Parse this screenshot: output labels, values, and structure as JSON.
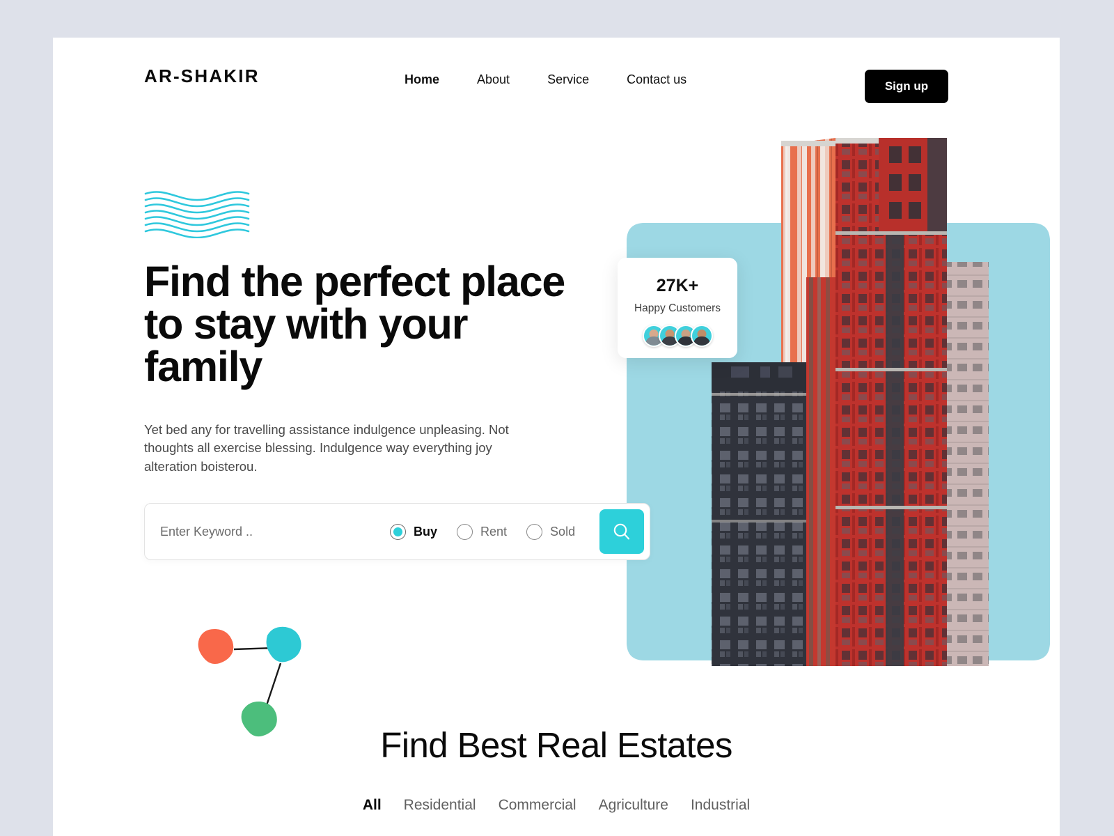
{
  "brand": {
    "logo": "AR-SHAKIR"
  },
  "nav": {
    "links": [
      {
        "label": "Home",
        "active": true
      },
      {
        "label": "About",
        "active": false
      },
      {
        "label": "Service",
        "active": false
      },
      {
        "label": "Contact us",
        "active": false
      }
    ],
    "signup_label": "Sign up"
  },
  "hero": {
    "title": "Find the perfect place to stay with your family",
    "description": "Yet bed any for travelling assistance indulgence unpleasing. Not thoughts all exercise blessing. Indulgence way everything joy alteration boisterou.",
    "wave_icon": "wave-lines-icon"
  },
  "search": {
    "placeholder": "Enter Keyword ..",
    "value": "",
    "options": [
      {
        "label": "Buy",
        "selected": true
      },
      {
        "label": "Rent",
        "selected": false
      },
      {
        "label": "Sold",
        "selected": false
      }
    ],
    "button_icon": "search-icon"
  },
  "stat_card": {
    "number": "27K+",
    "label": "Happy Customers",
    "avatars": [
      "avatar-1",
      "avatar-2",
      "avatar-3",
      "avatar-4"
    ]
  },
  "section": {
    "title": "Find Best Real Estates",
    "tabs": [
      {
        "label": "All",
        "active": true
      },
      {
        "label": "Residential",
        "active": false
      },
      {
        "label": "Commercial",
        "active": false
      },
      {
        "label": "Agriculture",
        "active": false
      },
      {
        "label": "Industrial",
        "active": false
      }
    ]
  },
  "colors": {
    "page_bg": "#dee1ea",
    "card_bg": "#ffffff",
    "accent_cyan": "#2dd0da",
    "panel_blue": "#9dd8e4",
    "pentagon_orange": "#f9684a",
    "pentagon_cyan": "#2dc9d4",
    "pentagon_green": "#4cbe7c",
    "button_black": "#000000"
  }
}
